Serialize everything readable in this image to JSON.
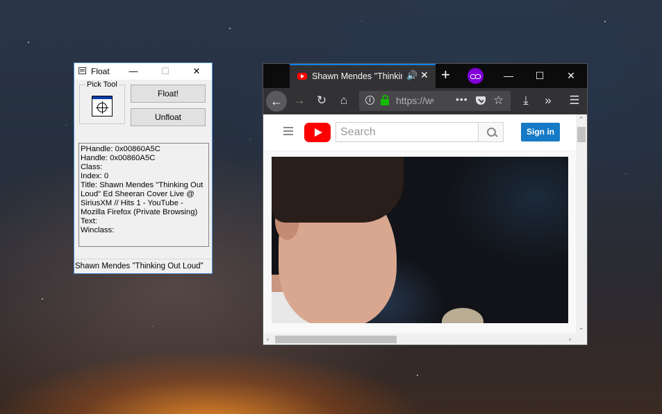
{
  "float_window": {
    "title": "Float",
    "controls": {
      "minimize": "—",
      "maximize": "☐",
      "close": "✕"
    },
    "pick_tool_label": "Pick Tool",
    "float_button": "Float!",
    "unfloat_button": "Unfloat",
    "info_lines": [
      "PHandle: 0x00860A5C",
      "Handle: 0x00860A5C",
      "Class:",
      "Index: 0",
      "Title: Shawn Mendes \"Thinking Out Loud\" Ed Sheeran Cover Live @ SiriusXM // Hits 1 - YouTube - Mozilla Firefox (Private Browsing)",
      "Text:",
      "Winclass:"
    ],
    "status": "Shawn Mendes \"Thinking Out Loud\""
  },
  "browser": {
    "tab_title": "Shawn Mendes \"Thinking Out Loud\"",
    "tab_audio_icon": "🔊",
    "tab_close": "✕",
    "new_tab": "+",
    "controls": {
      "minimize": "—",
      "maximize": "☐",
      "close": "✕"
    },
    "toolbar_icons": {
      "back": "←",
      "forward": "→",
      "reload": "↻",
      "home": "⌂",
      "download": "⤓",
      "overflow": "»",
      "menu": "☰"
    },
    "url": "https://www.youtube.com",
    "page_actions": "•••",
    "bookmark_star": "☆",
    "youtube": {
      "search_placeholder": "Search",
      "sign_in": "Sign in"
    },
    "scroll": {
      "up": "⌃",
      "down": "⌄",
      "left": "‹",
      "right": "›"
    },
    "accent_color": "#0a84ff",
    "private_color": "#8000d7"
  }
}
